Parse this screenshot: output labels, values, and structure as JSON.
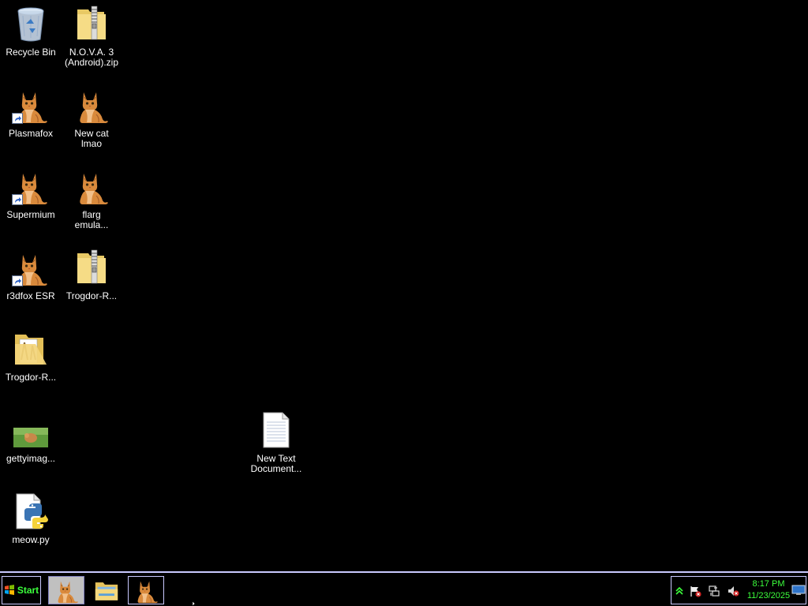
{
  "desktop": {
    "icons": [
      {
        "label": "Recycle Bin",
        "icon": "recycle-bin-icon"
      },
      {
        "label": "N.O.V.A. 3\n(Android).zip",
        "icon": "zip-folder-icon"
      },
      {
        "label": "Plasmafox",
        "icon": "cat-icon"
      },
      {
        "label": "New cat\nlmao",
        "icon": "cat-icon"
      },
      {
        "label": "Supermium",
        "icon": "cat-icon"
      },
      {
        "label": "flarg\nemula...",
        "icon": "cat-icon"
      },
      {
        "label": "r3dfox ESR",
        "icon": "cat-icon"
      },
      {
        "label": "Trogdor-R...",
        "icon": "zip-folder-icon"
      },
      {
        "label": "Trogdor-R...",
        "icon": "folder-icon"
      },
      {
        "label": "gettyimag...",
        "icon": "image-thumbnail-icon"
      },
      {
        "label": "New Text\nDocument...",
        "icon": "text-document-icon"
      },
      {
        "label": "meow.py",
        "icon": "python-file-icon"
      }
    ]
  },
  "taskbar": {
    "start_label": "Start",
    "buttons": [
      {
        "name": "cat-photo-task",
        "icon": "cat-icon"
      },
      {
        "name": "explorer-task",
        "icon": "file-explorer-icon"
      },
      {
        "name": "cat-app-task",
        "icon": "cat-icon"
      }
    ],
    "tray": {
      "icons": [
        "show-hidden-icons-chevron",
        "action-center-flag-icon",
        "network-icon",
        "volume-muted-icon",
        "show-desktop-icon"
      ],
      "time": "8:17 PM",
      "date": "11/23/2025"
    }
  },
  "colors": {
    "desktop_bg": "#000000",
    "taskbar_border": "#c9c9ff",
    "clock_text": "#3cff3c",
    "label_text": "#ffffff"
  }
}
